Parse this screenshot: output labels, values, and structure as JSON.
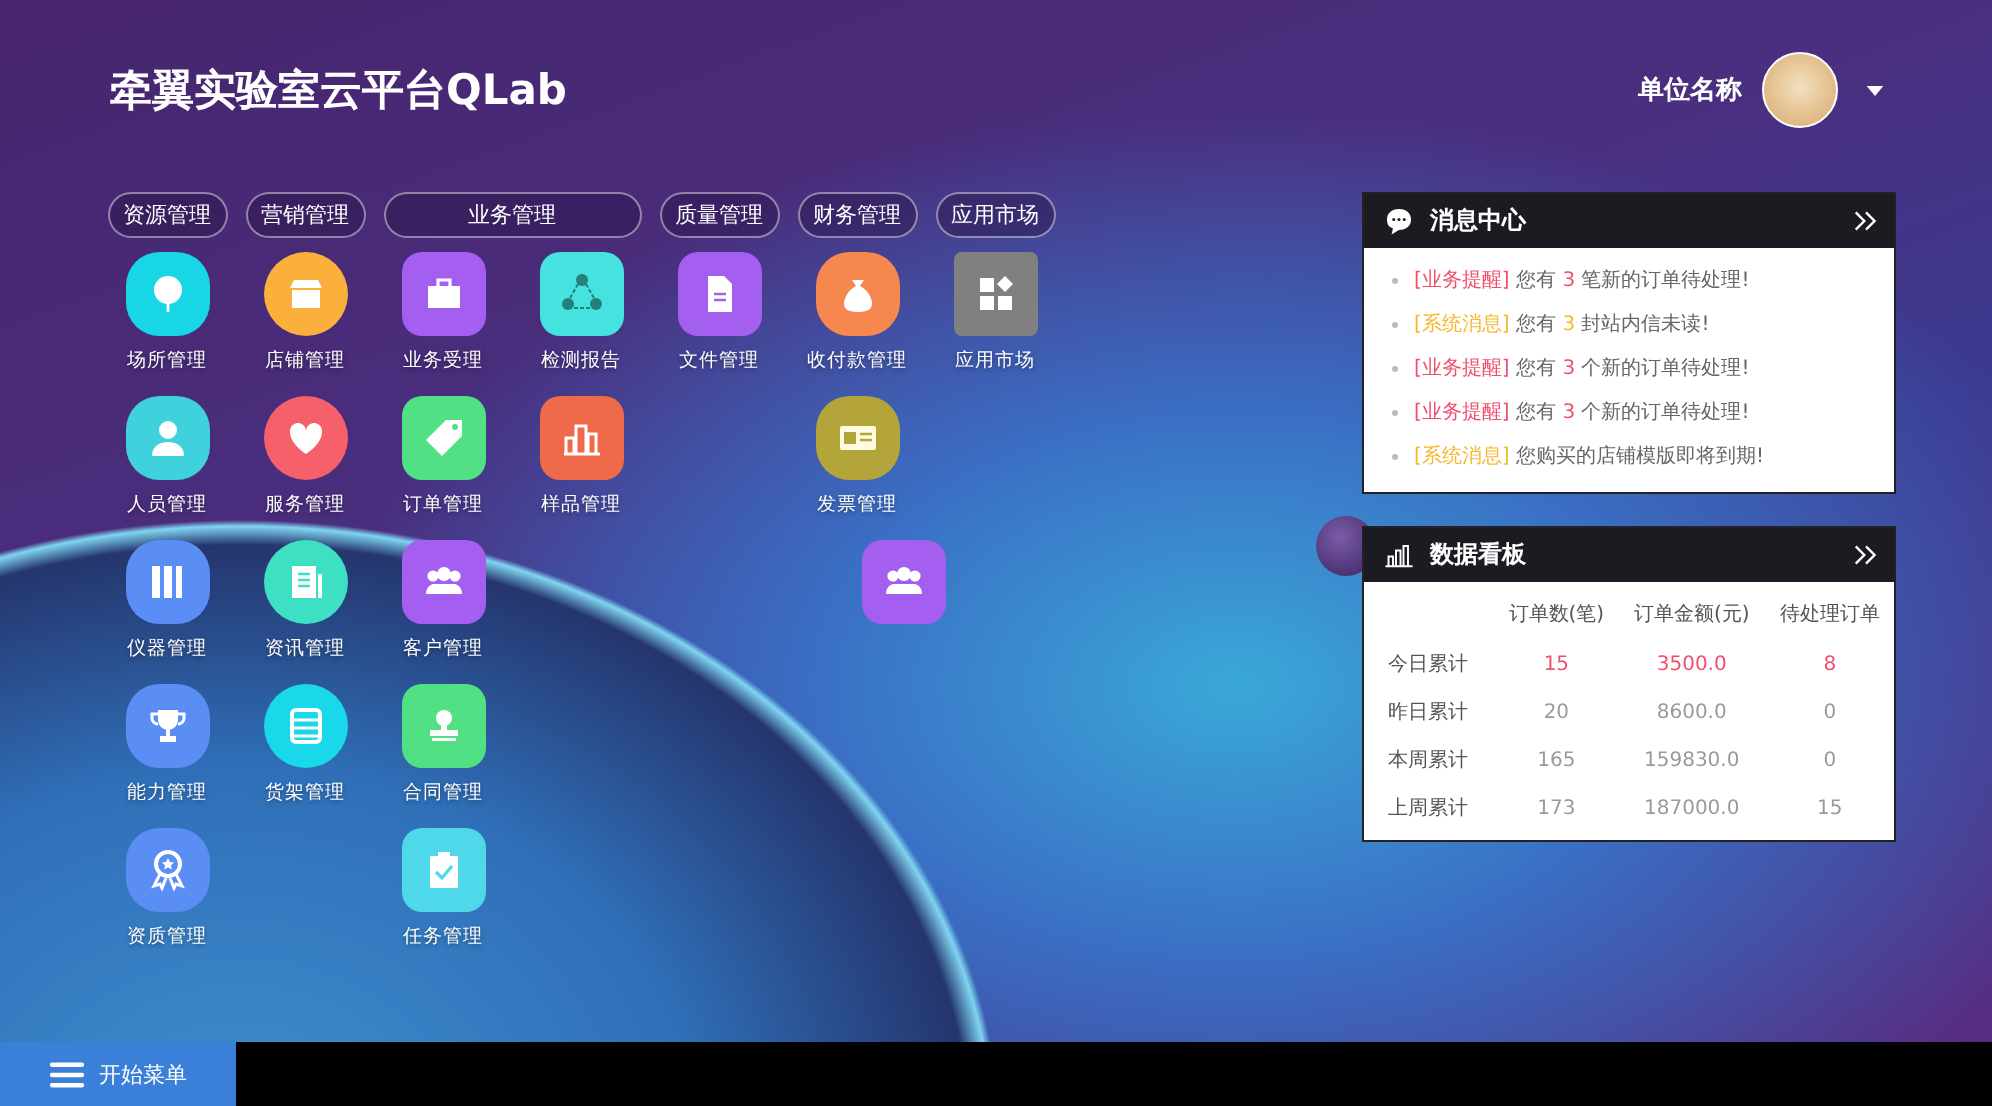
{
  "header": {
    "title": "牵翼实验室云平台QLab",
    "user_name": "单位名称"
  },
  "groups": [
    {
      "title": "资源管理",
      "columns": [
        [
          {
            "label": "场所管理",
            "kind": "squircle",
            "color": "#19d6e6"
          },
          {
            "label": "人员管理",
            "kind": "squircle",
            "color": "#3fd2dc"
          },
          {
            "label": "仪器管理",
            "kind": "squircle",
            "color": "#5b8ef5"
          },
          {
            "label": "能力管理",
            "kind": "squircle",
            "color": "#5b8ef5"
          },
          {
            "label": "资质管理",
            "kind": "squircle",
            "color": "#5b8ef5"
          }
        ]
      ]
    },
    {
      "title": "营销管理",
      "columns": [
        [
          {
            "label": "店铺管理",
            "kind": "round",
            "color": "#fbb03b"
          },
          {
            "label": "服务管理",
            "kind": "round",
            "color": "#f6606a"
          },
          {
            "label": "资讯管理",
            "kind": "round",
            "color": "#3ee0c4"
          },
          {
            "label": "货架管理",
            "kind": "round",
            "color": "#18d8ea"
          }
        ]
      ]
    },
    {
      "title": "业务管理",
      "columns": [
        [
          {
            "label": "业务受理",
            "kind": "square",
            "color": "#a45ef0"
          },
          {
            "label": "订单管理",
            "kind": "square",
            "color": "#52e085"
          },
          {
            "label": "客户管理",
            "kind": "square",
            "color": "#a45ef0"
          },
          {
            "label": "合同管理",
            "kind": "square",
            "color": "#52e085"
          },
          {
            "label": "任务管理",
            "kind": "square",
            "color": "#4fd8ea"
          }
        ],
        [
          {
            "label": "检测报告",
            "kind": "square",
            "color": "#46e2e0"
          },
          {
            "label": "样品管理",
            "kind": "square",
            "color": "#ef6a4a"
          }
        ]
      ]
    },
    {
      "title": "质量管理",
      "columns": [
        [
          {
            "label": "文件管理",
            "kind": "square",
            "color": "#a45ef0"
          }
        ]
      ]
    },
    {
      "title": "财务管理",
      "columns": [
        [
          {
            "label": "收付款管理",
            "kind": "squircle",
            "color": "#f5874f"
          },
          {
            "label": "发票管理",
            "kind": "squircle",
            "color": "#b3a53a"
          }
        ]
      ]
    },
    {
      "title": "应用市场",
      "columns": [
        [
          {
            "label": "应用市场",
            "kind": "plain",
            "color": "#808080"
          }
        ]
      ]
    }
  ],
  "floating_icon": {
    "kind": "square",
    "color": "#a45ef0"
  },
  "messages": {
    "title": "消息中心",
    "items": [
      {
        "tag": "[业务提醒]",
        "color": "#f0506e",
        "before": "您有",
        "count": "3",
        "after": "笔新的订单待处理!"
      },
      {
        "tag": "[系统消息]",
        "color": "#f5b82e",
        "before": "您有",
        "count": "3",
        "after": "封站内信未读!"
      },
      {
        "tag": "[业务提醒]",
        "color": "#f0506e",
        "before": "您有",
        "count": "3",
        "after": "个新的订单待处理!"
      },
      {
        "tag": "[业务提醒]",
        "color": "#f0506e",
        "before": "您有",
        "count": "3",
        "after": "个新的订单待处理!"
      },
      {
        "tag": "[系统消息]",
        "color": "#f5b82e",
        "before": "您购买的店铺模版即将到期!"
      }
    ]
  },
  "dashboard": {
    "title": "数据看板",
    "columns": [
      "订单数(笔)",
      "订单金额(元)",
      "待处理订单"
    ],
    "rows": [
      {
        "label": "今日累计",
        "values": [
          "15",
          "3500.0",
          "8"
        ],
        "highlighted": true
      },
      {
        "label": "昨日累计",
        "values": [
          "20",
          "8600.0",
          "0"
        ],
        "highlighted": false
      },
      {
        "label": "本周累计",
        "values": [
          "165",
          "159830.0",
          "0"
        ],
        "highlighted": false
      },
      {
        "label": "上周累计",
        "values": [
          "173",
          "187000.0",
          "15"
        ],
        "highlighted": false
      }
    ]
  },
  "taskbar": {
    "start_label": "开始菜单"
  }
}
